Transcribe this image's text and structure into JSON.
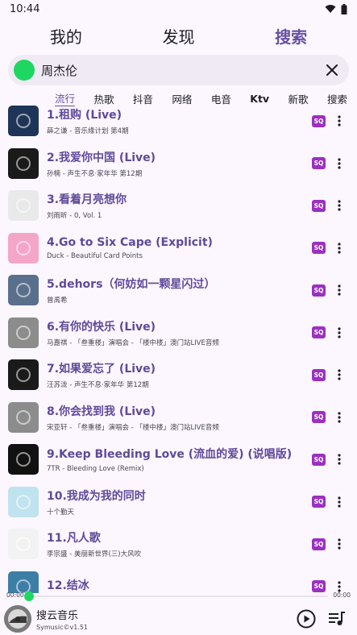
{
  "status": {
    "time": "10:44"
  },
  "top_tabs": [
    {
      "label": "我的",
      "active": false
    },
    {
      "label": "发现",
      "active": false
    },
    {
      "label": "搜索",
      "active": true
    }
  ],
  "search": {
    "value": "周杰伦"
  },
  "categories": [
    {
      "label": "流行",
      "active": true,
      "bold": false
    },
    {
      "label": "热歌",
      "active": false,
      "bold": false
    },
    {
      "label": "抖音",
      "active": false,
      "bold": false
    },
    {
      "label": "网络",
      "active": false,
      "bold": false
    },
    {
      "label": "电音",
      "active": false,
      "bold": false
    },
    {
      "label": "Ktv",
      "active": false,
      "bold": true
    },
    {
      "label": "新歌",
      "active": false,
      "bold": false
    },
    {
      "label": "搜索",
      "active": false,
      "bold": false
    }
  ],
  "songs": [
    {
      "title": "1.租购 (Live)",
      "subtitle": "薛之谦 - 音乐缘计划 第4期",
      "badge": "SQ",
      "cover_color": "#1f3557"
    },
    {
      "title": "2.我爱你中国 (Live)",
      "subtitle": "孙楠 - 声生不息·家年华 第12期",
      "badge": "SQ",
      "cover_color": "#1a1a1a"
    },
    {
      "title": "3.看着月亮想你",
      "subtitle": "刘雨昕 - 0, Vol. 1",
      "badge": "SQ",
      "cover_color": "#e9e9e9"
    },
    {
      "title": "4.Go to Six Cape (Explicit)",
      "subtitle": "Duck - Beautiful Card Points",
      "badge": "SQ",
      "cover_color": "#f4a6c7"
    },
    {
      "title": "5.dehors（何妨如一颗星闪过）",
      "subtitle": "曾禹希",
      "badge": "SQ",
      "cover_color": "#5a6f8c"
    },
    {
      "title": "6.有你的快乐 (Live)",
      "subtitle": "马嘉祺 - 「叁重楼」演唱会 - 「楼中楼」澳门站LIVE音频",
      "badge": "SQ",
      "cover_color": "#8c8c8c"
    },
    {
      "title": "7.如果爱忘了 (Live)",
      "subtitle": "汪苏泷 - 声生不息·家年华 第12期",
      "badge": "SQ",
      "cover_color": "#1a1a1a"
    },
    {
      "title": "8.你会找到我 (Live)",
      "subtitle": "宋亚轩 - 「叁重楼」演唱会 - 「楼中楼」澳门站LIVE音频",
      "badge": "SQ",
      "cover_color": "#8c8c8c"
    },
    {
      "title": "9.Keep Bleeding Love (流血的爱) (说唱版)",
      "subtitle": "7TR - Bleeding Love (Remix)",
      "badge": "SQ",
      "cover_color": "#111111"
    },
    {
      "title": "10.我成为我的同时",
      "subtitle": "十个勤天",
      "badge": "SQ",
      "cover_color": "#bfe3ef"
    },
    {
      "title": "11.凡人歌",
      "subtitle": "李宗盛 - 美丽新世界(三)大风吹",
      "badge": "SQ",
      "cover_color": "#f2f2f2"
    },
    {
      "title": "12.结冰",
      "subtitle": "",
      "badge": "SQ",
      "cover_color": "#3d7ea6"
    }
  ],
  "progress": {
    "current": "00:00",
    "total": "00:00",
    "fraction": 0
  },
  "player": {
    "title": "搜云音乐",
    "subtitle": "Symusic©v1.51"
  },
  "colors": {
    "accent": "#6750a4",
    "badge": "#9b30c2",
    "green": "#1ed760"
  }
}
